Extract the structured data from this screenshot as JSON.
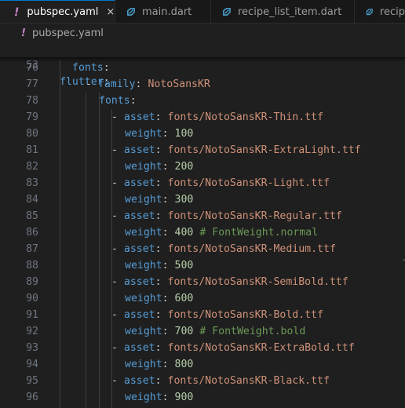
{
  "tabs": [
    {
      "label": "pubspec.yaml",
      "icon": "yaml-icon",
      "glyph": "!",
      "close": "×",
      "active": true
    },
    {
      "label": "main.dart",
      "icon": "dart-icon",
      "active": false
    },
    {
      "label": "recipe_list_item.dart",
      "icon": "dart-icon",
      "active": false
    },
    {
      "label": "recip",
      "icon": "dart-icon",
      "active": false
    }
  ],
  "breadcrumb": {
    "glyph": "!",
    "file": "pubspec.yaml"
  },
  "colors": {
    "key": "#569cd6",
    "string": "#ce9178",
    "number": "#b5cea8",
    "comment": "#6a9955",
    "accent": "#0078d4"
  },
  "sticky": {
    "line": "53",
    "key": "flutter",
    "colon": ":"
  },
  "lines": [
    {
      "ln": "76",
      "key": "fonts",
      "colon": ":"
    },
    {
      "ln": "77",
      "dash": "-",
      "key": "family",
      "colon": ":",
      "value": "NotoSansKR"
    },
    {
      "ln": "78",
      "key": "fonts",
      "colon": ":"
    },
    {
      "ln": "79",
      "dash": "-",
      "key": "asset",
      "colon": ":",
      "value": "fonts/NotoSansKR-Thin.ttf"
    },
    {
      "ln": "80",
      "key": "weight",
      "colon": ":",
      "value": "100"
    },
    {
      "ln": "81",
      "dash": "-",
      "key": "asset",
      "colon": ":",
      "value": "fonts/NotoSansKR-ExtraLight.ttf"
    },
    {
      "ln": "82",
      "key": "weight",
      "colon": ":",
      "value": "200"
    },
    {
      "ln": "83",
      "dash": "-",
      "key": "asset",
      "colon": ":",
      "value": "fonts/NotoSansKR-Light.ttf"
    },
    {
      "ln": "84",
      "key": "weight",
      "colon": ":",
      "value": "300"
    },
    {
      "ln": "85",
      "dash": "-",
      "key": "asset",
      "colon": ":",
      "value": "fonts/NotoSansKR-Regular.ttf"
    },
    {
      "ln": "86",
      "key": "weight",
      "colon": ":",
      "value": "400",
      "comment": "# FontWeight.normal"
    },
    {
      "ln": "87",
      "dash": "-",
      "key": "asset",
      "colon": ":",
      "value": "fonts/NotoSansKR-Medium.ttf"
    },
    {
      "ln": "88",
      "key": "weight",
      "colon": ":",
      "value": "500"
    },
    {
      "ln": "89",
      "dash": "-",
      "key": "asset",
      "colon": ":",
      "value": "fonts/NotoSansKR-SemiBold.ttf"
    },
    {
      "ln": "90",
      "key": "weight",
      "colon": ":",
      "value": "600"
    },
    {
      "ln": "91",
      "dash": "-",
      "key": "asset",
      "colon": ":",
      "value": "fonts/NotoSansKR-Bold.ttf"
    },
    {
      "ln": "92",
      "key": "weight",
      "colon": ":",
      "value": "700",
      "comment": "# FontWeight.bold"
    },
    {
      "ln": "93",
      "dash": "-",
      "key": "asset",
      "colon": ":",
      "value": "fonts/NotoSansKR-ExtraBold.ttf"
    },
    {
      "ln": "94",
      "key": "weight",
      "colon": ":",
      "value": "800"
    },
    {
      "ln": "95",
      "dash": "-",
      "key": "asset",
      "colon": ":",
      "value": "fonts/NotoSansKR-Black.ttf"
    },
    {
      "ln": "96",
      "key": "weight",
      "colon": ":",
      "value": "900"
    }
  ]
}
